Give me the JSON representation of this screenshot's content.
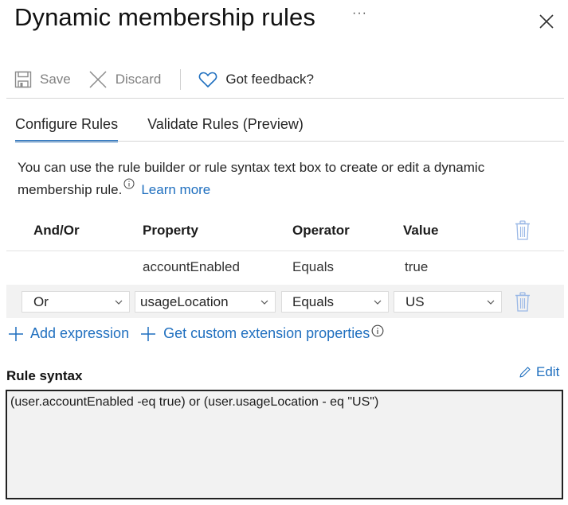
{
  "header": {
    "title": "Dynamic membership rules",
    "more_label": "···",
    "close_icon": "close-icon"
  },
  "toolbar": {
    "save_label": "Save",
    "discard_label": "Discard",
    "feedback_label": "Got feedback?",
    "icons": {
      "save": "save-icon",
      "discard": "discard-x-icon",
      "feedback": "heart-icon"
    }
  },
  "tabs": [
    {
      "label": "Configure Rules",
      "active": true
    },
    {
      "label": "Validate Rules (Preview)",
      "active": false
    }
  ],
  "description": {
    "text": "You can use the rule builder or rule syntax text box to create or edit a dynamic membership rule.",
    "learn_more": "Learn more"
  },
  "rule_builder": {
    "columns": [
      "And/Or",
      "Property",
      "Operator",
      "Value"
    ],
    "rows": [
      {
        "and_or": "",
        "property": "accountEnabled",
        "operator": "Equals",
        "value": "true",
        "editable": false
      },
      {
        "and_or": "Or",
        "property": "usageLocation",
        "operator": "Equals",
        "value": "US",
        "editable": true
      }
    ]
  },
  "actions": {
    "add_expression": "Add expression",
    "custom_extension": "Get custom extension properties"
  },
  "rule_syntax": {
    "label": "Rule syntax",
    "edit_label": "Edit",
    "value": "(user.accountEnabled -eq true) or (user.usageLocation - eq \"US\")"
  },
  "colors": {
    "accent": "#1f6fbf",
    "trash": "#9ab8e6",
    "syntax_bg": "#f2f2f2"
  }
}
